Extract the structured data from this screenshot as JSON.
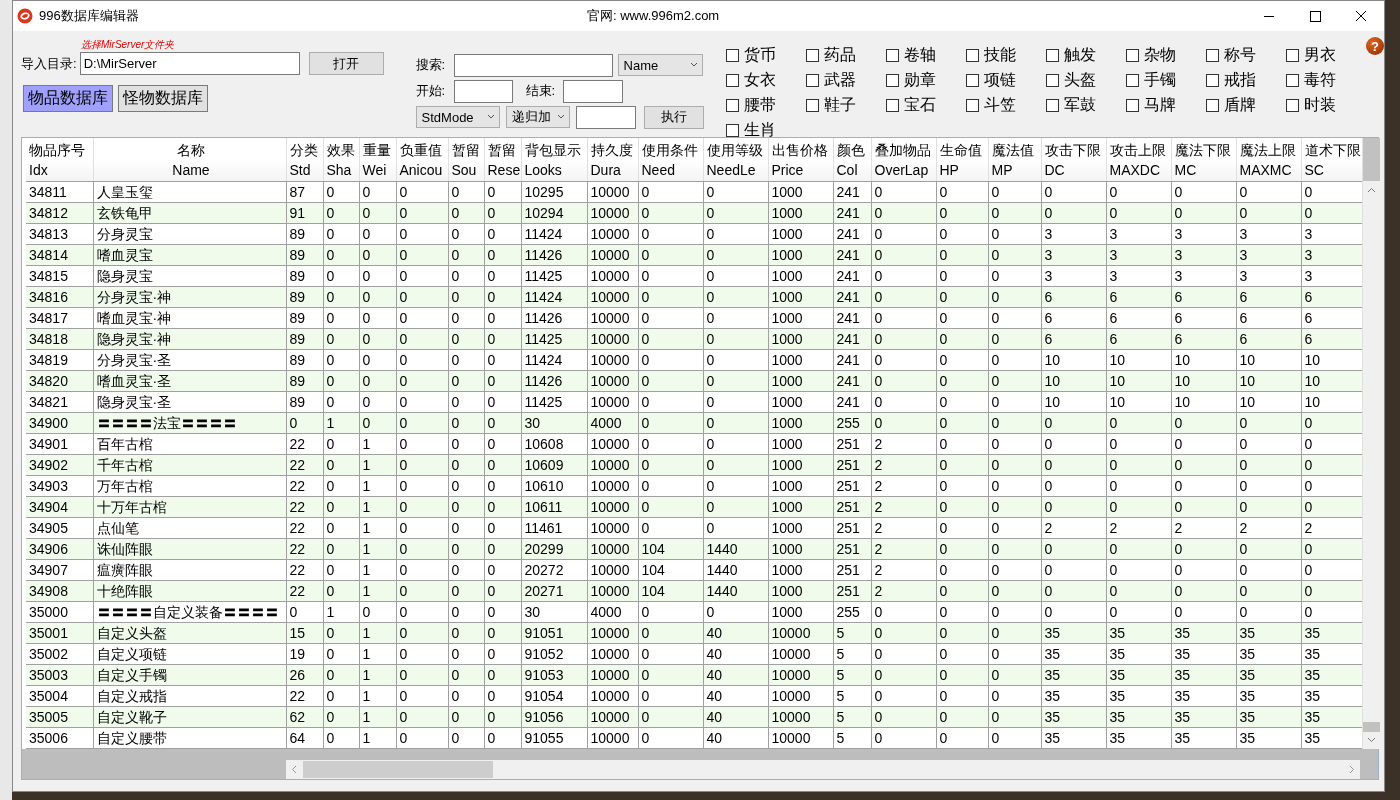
{
  "window": {
    "title": "996数据库编辑器",
    "website": "官网: www.996m2.com"
  },
  "import": {
    "hint": "选择MirServer文件夹",
    "label": "导入目录:",
    "path": "D:\\MirServer",
    "open_button": "打开"
  },
  "database_tabs": [
    {
      "label": "物品数据库",
      "selected": true
    },
    {
      "label": "怪物数据库",
      "selected": false
    }
  ],
  "search": {
    "label": "搜索:",
    "field_dropdown": "Name",
    "start_label": "开始:",
    "end_label": "结束:",
    "mode_dropdown": "StdMode",
    "op_dropdown": "递归加",
    "execute_button": "执行"
  },
  "categories": [
    {
      "label": "货币",
      "checked": false
    },
    {
      "label": "药品",
      "checked": false
    },
    {
      "label": "卷轴",
      "checked": false
    },
    {
      "label": "技能",
      "checked": false
    },
    {
      "label": "触发",
      "checked": false
    },
    {
      "label": "杂物",
      "checked": false
    },
    {
      "label": "称号",
      "checked": false
    },
    {
      "label": "男衣",
      "checked": false
    },
    {
      "label": "女衣",
      "checked": false
    },
    {
      "label": "武器",
      "checked": false
    },
    {
      "label": "勋章",
      "checked": false
    },
    {
      "label": "项链",
      "checked": false
    },
    {
      "label": "头盔",
      "checked": false
    },
    {
      "label": "手镯",
      "checked": false
    },
    {
      "label": "戒指",
      "checked": false
    },
    {
      "label": "毒符",
      "checked": false
    },
    {
      "label": "腰带",
      "checked": false
    },
    {
      "label": "鞋子",
      "checked": false
    },
    {
      "label": "宝石",
      "checked": false
    },
    {
      "label": "斗笠",
      "checked": false
    },
    {
      "label": "军鼓",
      "checked": false
    },
    {
      "label": "马牌",
      "checked": false
    },
    {
      "label": "盾牌",
      "checked": false
    },
    {
      "label": "时装",
      "checked": false
    },
    {
      "label": "生肖",
      "checked": false
    }
  ],
  "help": "?",
  "table": {
    "columns": [
      {
        "zh": "物品序号",
        "en": "Idx"
      },
      {
        "zh": "名称",
        "en": "Name"
      },
      {
        "zh": "分类",
        "en": "Std"
      },
      {
        "zh": "效果",
        "en": "Sha"
      },
      {
        "zh": "重量",
        "en": "Wei"
      },
      {
        "zh": "负重值",
        "en": "Anicou"
      },
      {
        "zh": "暂留",
        "en": "Sou"
      },
      {
        "zh": "暂留",
        "en": "Rese"
      },
      {
        "zh": "背包显示",
        "en": "Looks"
      },
      {
        "zh": "持久度",
        "en": "Dura"
      },
      {
        "zh": "使用条件",
        "en": "Need"
      },
      {
        "zh": "使用等级",
        "en": "NeedLe"
      },
      {
        "zh": "出售价格",
        "en": "Price"
      },
      {
        "zh": "颜色",
        "en": "Col"
      },
      {
        "zh": "叠加物品",
        "en": "OverLap"
      },
      {
        "zh": "生命值",
        "en": "HP"
      },
      {
        "zh": "魔法值",
        "en": "MP"
      },
      {
        "zh": "攻击下限",
        "en": "DC"
      },
      {
        "zh": "攻击上限",
        "en": "MAXDC"
      },
      {
        "zh": "魔法下限",
        "en": "MC"
      },
      {
        "zh": "魔法上限",
        "en": "MAXMC"
      },
      {
        "zh": "道术下限",
        "en": "SC"
      }
    ],
    "rows": [
      [
        "34811",
        "人皇玉玺",
        "87",
        "0",
        "0",
        "0",
        "0",
        "0",
        "10295",
        "10000",
        "0",
        "0",
        "1000",
        "241",
        "0",
        "0",
        "0",
        "0",
        "0",
        "0",
        "0",
        "0"
      ],
      [
        "34812",
        "玄铁龟甲",
        "91",
        "0",
        "0",
        "0",
        "0",
        "0",
        "10294",
        "10000",
        "0",
        "0",
        "1000",
        "241",
        "0",
        "0",
        "0",
        "0",
        "0",
        "0",
        "0",
        "0"
      ],
      [
        "34813",
        "分身灵宝",
        "89",
        "0",
        "0",
        "0",
        "0",
        "0",
        "11424",
        "10000",
        "0",
        "0",
        "1000",
        "241",
        "0",
        "0",
        "0",
        "3",
        "3",
        "3",
        "3",
        "3"
      ],
      [
        "34814",
        "嗜血灵宝",
        "89",
        "0",
        "0",
        "0",
        "0",
        "0",
        "11426",
        "10000",
        "0",
        "0",
        "1000",
        "241",
        "0",
        "0",
        "0",
        "3",
        "3",
        "3",
        "3",
        "3"
      ],
      [
        "34815",
        "隐身灵宝",
        "89",
        "0",
        "0",
        "0",
        "0",
        "0",
        "11425",
        "10000",
        "0",
        "0",
        "1000",
        "241",
        "0",
        "0",
        "0",
        "3",
        "3",
        "3",
        "3",
        "3"
      ],
      [
        "34816",
        "分身灵宝·神",
        "89",
        "0",
        "0",
        "0",
        "0",
        "0",
        "11424",
        "10000",
        "0",
        "0",
        "1000",
        "241",
        "0",
        "0",
        "0",
        "6",
        "6",
        "6",
        "6",
        "6"
      ],
      [
        "34817",
        "嗜血灵宝·神",
        "89",
        "0",
        "0",
        "0",
        "0",
        "0",
        "11426",
        "10000",
        "0",
        "0",
        "1000",
        "241",
        "0",
        "0",
        "0",
        "6",
        "6",
        "6",
        "6",
        "6"
      ],
      [
        "34818",
        "隐身灵宝·神",
        "89",
        "0",
        "0",
        "0",
        "0",
        "0",
        "11425",
        "10000",
        "0",
        "0",
        "1000",
        "241",
        "0",
        "0",
        "0",
        "6",
        "6",
        "6",
        "6",
        "6"
      ],
      [
        "34819",
        "分身灵宝·圣",
        "89",
        "0",
        "0",
        "0",
        "0",
        "0",
        "11424",
        "10000",
        "0",
        "0",
        "1000",
        "241",
        "0",
        "0",
        "0",
        "10",
        "10",
        "10",
        "10",
        "10"
      ],
      [
        "34820",
        "嗜血灵宝·圣",
        "89",
        "0",
        "0",
        "0",
        "0",
        "0",
        "11426",
        "10000",
        "0",
        "0",
        "1000",
        "241",
        "0",
        "0",
        "0",
        "10",
        "10",
        "10",
        "10",
        "10"
      ],
      [
        "34821",
        "隐身灵宝·圣",
        "89",
        "0",
        "0",
        "0",
        "0",
        "0",
        "11425",
        "10000",
        "0",
        "0",
        "1000",
        "241",
        "0",
        "0",
        "0",
        "10",
        "10",
        "10",
        "10",
        "10"
      ],
      [
        "34900",
        "〓〓〓〓法宝〓〓〓〓",
        "0",
        "1",
        "0",
        "0",
        "0",
        "0",
        "30",
        "4000",
        "0",
        "0",
        "1000",
        "255",
        "0",
        "0",
        "0",
        "0",
        "0",
        "0",
        "0",
        "0"
      ],
      [
        "34901",
        "百年古棺",
        "22",
        "0",
        "1",
        "0",
        "0",
        "0",
        "10608",
        "10000",
        "0",
        "0",
        "1000",
        "251",
        "2",
        "0",
        "0",
        "0",
        "0",
        "0",
        "0",
        "0"
      ],
      [
        "34902",
        "千年古棺",
        "22",
        "0",
        "1",
        "0",
        "0",
        "0",
        "10609",
        "10000",
        "0",
        "0",
        "1000",
        "251",
        "2",
        "0",
        "0",
        "0",
        "0",
        "0",
        "0",
        "0"
      ],
      [
        "34903",
        "万年古棺",
        "22",
        "0",
        "1",
        "0",
        "0",
        "0",
        "10610",
        "10000",
        "0",
        "0",
        "1000",
        "251",
        "2",
        "0",
        "0",
        "0",
        "0",
        "0",
        "0",
        "0"
      ],
      [
        "34904",
        "十万年古棺",
        "22",
        "0",
        "1",
        "0",
        "0",
        "0",
        "10611",
        "10000",
        "0",
        "0",
        "1000",
        "251",
        "2",
        "0",
        "0",
        "0",
        "0",
        "0",
        "0",
        "0"
      ],
      [
        "34905",
        "点仙笔",
        "22",
        "0",
        "1",
        "0",
        "0",
        "0",
        "11461",
        "10000",
        "0",
        "0",
        "1000",
        "251",
        "2",
        "0",
        "0",
        "2",
        "2",
        "2",
        "2",
        "2"
      ],
      [
        "34906",
        "诛仙阵眼",
        "22",
        "0",
        "1",
        "0",
        "0",
        "0",
        "20299",
        "10000",
        "104",
        "1440",
        "1000",
        "251",
        "2",
        "0",
        "0",
        "0",
        "0",
        "0",
        "0",
        "0"
      ],
      [
        "34907",
        "瘟癀阵眼",
        "22",
        "0",
        "1",
        "0",
        "0",
        "0",
        "20272",
        "10000",
        "104",
        "1440",
        "1000",
        "251",
        "2",
        "0",
        "0",
        "0",
        "0",
        "0",
        "0",
        "0"
      ],
      [
        "34908",
        "十绝阵眼",
        "22",
        "0",
        "1",
        "0",
        "0",
        "0",
        "20271",
        "10000",
        "104",
        "1440",
        "1000",
        "251",
        "2",
        "0",
        "0",
        "0",
        "0",
        "0",
        "0",
        "0"
      ],
      [
        "35000",
        "〓〓〓〓自定义装备〓〓〓〓",
        "0",
        "1",
        "0",
        "0",
        "0",
        "0",
        "30",
        "4000",
        "0",
        "0",
        "1000",
        "255",
        "0",
        "0",
        "0",
        "0",
        "0",
        "0",
        "0",
        "0"
      ],
      [
        "35001",
        "自定义头盔",
        "15",
        "0",
        "1",
        "0",
        "0",
        "0",
        "91051",
        "10000",
        "0",
        "40",
        "10000",
        "5",
        "0",
        "0",
        "0",
        "35",
        "35",
        "35",
        "35",
        "35"
      ],
      [
        "35002",
        "自定义项链",
        "19",
        "0",
        "1",
        "0",
        "0",
        "0",
        "91052",
        "10000",
        "0",
        "40",
        "10000",
        "5",
        "0",
        "0",
        "0",
        "35",
        "35",
        "35",
        "35",
        "35"
      ],
      [
        "35003",
        "自定义手镯",
        "26",
        "0",
        "1",
        "0",
        "0",
        "0",
        "91053",
        "10000",
        "0",
        "40",
        "10000",
        "5",
        "0",
        "0",
        "0",
        "35",
        "35",
        "35",
        "35",
        "35"
      ],
      [
        "35004",
        "自定义戒指",
        "22",
        "0",
        "1",
        "0",
        "0",
        "0",
        "91054",
        "10000",
        "0",
        "40",
        "10000",
        "5",
        "0",
        "0",
        "0",
        "35",
        "35",
        "35",
        "35",
        "35"
      ],
      [
        "35005",
        "自定义靴子",
        "62",
        "0",
        "1",
        "0",
        "0",
        "0",
        "91056",
        "10000",
        "0",
        "40",
        "10000",
        "5",
        "0",
        "0",
        "0",
        "35",
        "35",
        "35",
        "35",
        "35"
      ],
      [
        "35006",
        "自定义腰带",
        "64",
        "0",
        "1",
        "0",
        "0",
        "0",
        "91055",
        "10000",
        "0",
        "40",
        "10000",
        "5",
        "0",
        "0",
        "0",
        "35",
        "35",
        "35",
        "35",
        "35"
      ]
    ]
  }
}
